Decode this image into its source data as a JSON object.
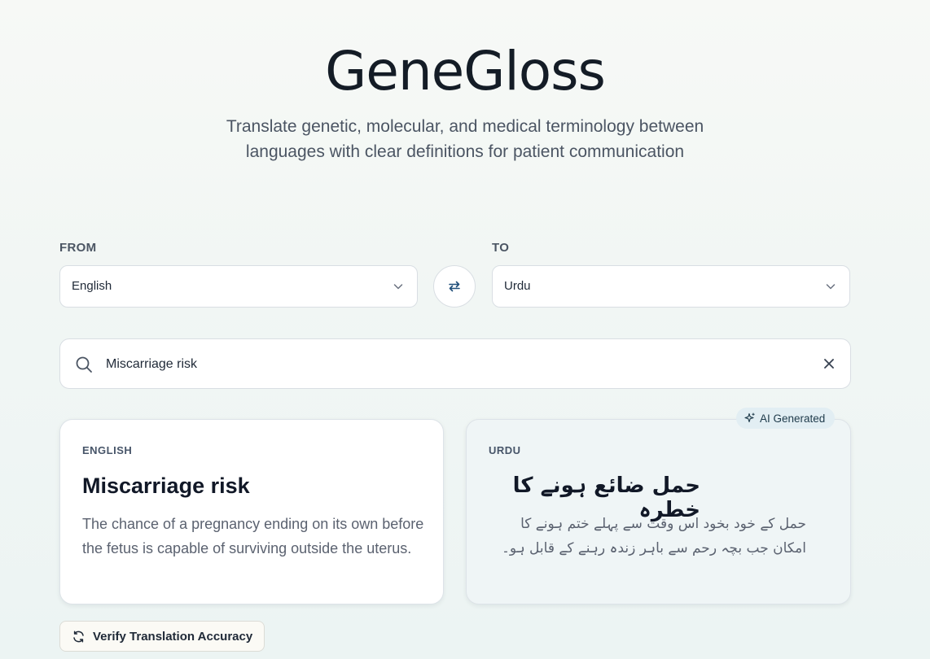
{
  "app": {
    "title": "GeneGloss",
    "subtitle_line1": "Translate genetic, molecular, and medical terminology between",
    "subtitle_line2": "languages with clear definitions for patient communication"
  },
  "from": {
    "label": "FROM",
    "value": "English"
  },
  "to": {
    "label": "TO",
    "value": "Urdu"
  },
  "search": {
    "value": "Miscarriage risk"
  },
  "source_card": {
    "language": "ENGLISH",
    "term": "Miscarriage risk",
    "definition": "The chance of a pregnancy ending on its own before the fetus is capable of surviving outside the uterus."
  },
  "target_card": {
    "language": "URDU",
    "term": "حمل ضائع ہونے کا خطرہ",
    "definition": "حمل کے خود بخود اس وقت سے پہلے ختم ہونے کا امکان جب بچہ رحم سے باہر زندہ رہنے کے قابل ہو۔"
  },
  "badge": {
    "label": "AI Generated"
  },
  "verify_button": {
    "label": "Verify Translation Accuracy"
  },
  "icons": [
    "search-icon",
    "clear-icon",
    "swap-icon",
    "chevron-down-icon",
    "sparkle-icon",
    "refresh-icon"
  ]
}
